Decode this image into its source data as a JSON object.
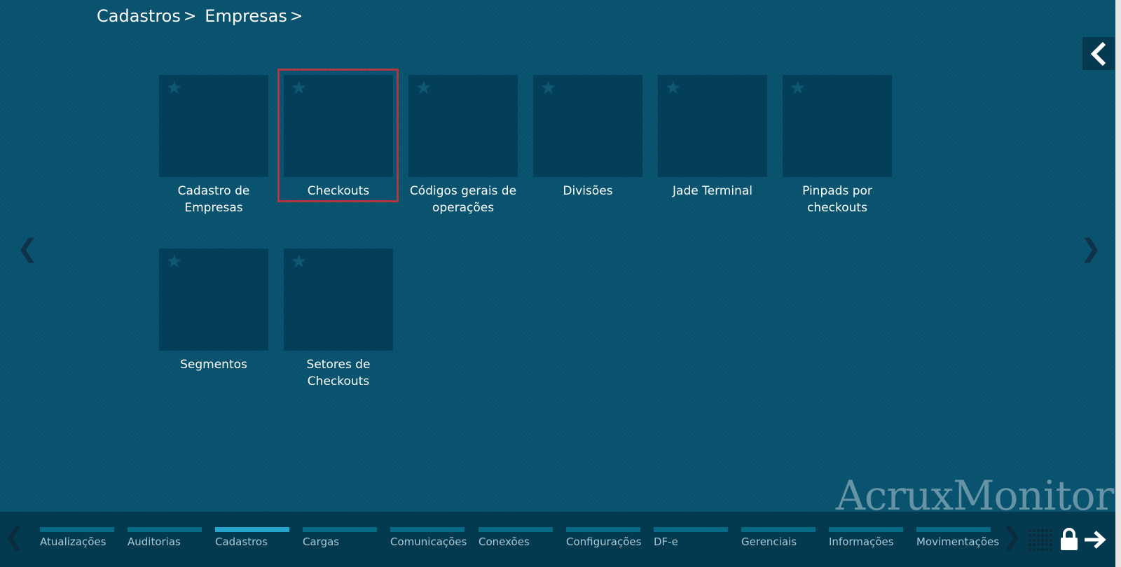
{
  "breadcrumb": {
    "items": [
      {
        "label": "Cadastros",
        "separator": ">"
      },
      {
        "label": "Empresas",
        "separator": ">"
      }
    ]
  },
  "nav": {
    "prev_icon": "chevron-left-icon",
    "next_icon": "chevron-right-icon",
    "back_icon": "back-chevron-icon"
  },
  "tiles": [
    {
      "label": "Cadastro de Empresas",
      "icon": "star-icon"
    },
    {
      "label": "Checkouts",
      "icon": "star-icon",
      "selected": true
    },
    {
      "label": "Códigos gerais de operações",
      "icon": "star-icon"
    },
    {
      "label": "Divisões",
      "icon": "star-icon"
    },
    {
      "label": "Jade Terminal",
      "icon": "star-icon"
    },
    {
      "label": "Pinpads por checkouts",
      "icon": "star-icon"
    },
    {
      "label": "Segmentos",
      "icon": "star-icon"
    },
    {
      "label": "Setores de Checkouts",
      "icon": "star-icon"
    }
  ],
  "brand": "AcruxMonitor",
  "bottom_tabs": [
    {
      "label": "Atualizações"
    },
    {
      "label": "Auditorias"
    },
    {
      "label": "Cadastros",
      "active": true
    },
    {
      "label": "Cargas"
    },
    {
      "label": "Comunicações"
    },
    {
      "label": "Conexões"
    },
    {
      "label": "Configurações"
    },
    {
      "label": "DF-e"
    },
    {
      "label": "Gerenciais"
    },
    {
      "label": "Informações"
    },
    {
      "label": "Movimentações"
    }
  ],
  "colors": {
    "background": "#07526e",
    "tile": "#033f58",
    "bottom_bar": "#033a4f",
    "active_tab": "#24a3cc",
    "selection": "#b0373f"
  }
}
